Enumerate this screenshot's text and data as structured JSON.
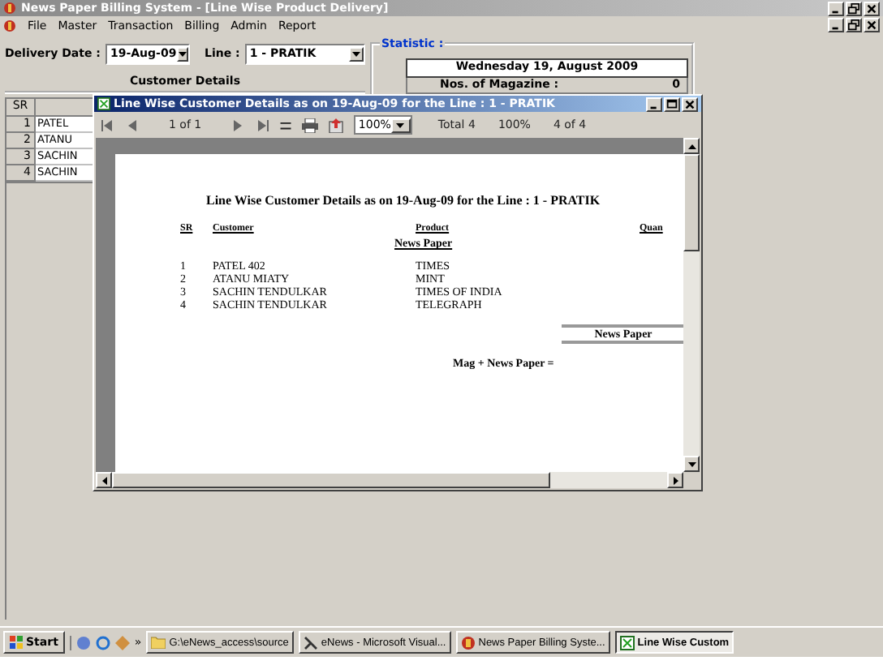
{
  "app_window": {
    "title": "News Paper Billing System - [Line Wise Product Delivery]"
  },
  "menu": [
    "File",
    "Master",
    "Transaction",
    "Billing",
    "Admin",
    "Report"
  ],
  "filters": {
    "delivery_date_label": "Delivery Date :",
    "delivery_date": "19-Aug-09",
    "line_label": "Line :",
    "line": "1 - PRATIK"
  },
  "customer_details": {
    "title": "Customer Details",
    "sr_heading": "SR",
    "rows": [
      {
        "sr": "1",
        "name": "PATEL"
      },
      {
        "sr": "2",
        "name": "ATANU"
      },
      {
        "sr": "3",
        "name": "SACHIN"
      },
      {
        "sr": "4",
        "name": "SACHIN"
      }
    ]
  },
  "statistic": {
    "title": "Statistic :",
    "date": "Wednesday 19, August 2009",
    "magazine_label": "Nos. of Magazine :",
    "magazine_count": "0"
  },
  "report_window": {
    "title": "Line Wise Customer Details as on 19-Aug-09 for the Line :  1 - PRATIK",
    "toolbar": {
      "page": "1 of 1",
      "stop": "=",
      "zoom": "100%",
      "total": "Total 4",
      "percent": "100%",
      "records": "4 of 4"
    },
    "report": {
      "title": "Line Wise Customer Details as on 19-Aug-09 for the Line :  1 - PRATIK",
      "columns": [
        "SR",
        "Customer",
        "Product",
        "Quan"
      ],
      "group": "News Paper",
      "rows": [
        {
          "sr": "1",
          "customer": "PATEL 402",
          "product": "TIMES"
        },
        {
          "sr": "2",
          "customer": "ATANU MIATY",
          "product": "MINT"
        },
        {
          "sr": "3",
          "customer": "SACHIN TENDULKAR",
          "product": "TIMES OF INDIA"
        },
        {
          "sr": "4",
          "customer": "SACHIN TENDULKAR",
          "product": "TELEGRAPH"
        }
      ],
      "summary_heading": "News Paper",
      "total_label": "Mag + News Paper ="
    }
  },
  "taskbar": {
    "start": "Start",
    "more": "»",
    "items": [
      {
        "label": "G:\\eNews_access\\source",
        "kind": "folder",
        "selected": false
      },
      {
        "label": "eNews - Microsoft Visual...",
        "kind": "ide",
        "selected": false
      },
      {
        "label": "News Paper Billing Syste...",
        "kind": "app",
        "selected": false
      },
      {
        "label": "Line Wise Custom",
        "kind": "report",
        "selected": true
      }
    ]
  }
}
